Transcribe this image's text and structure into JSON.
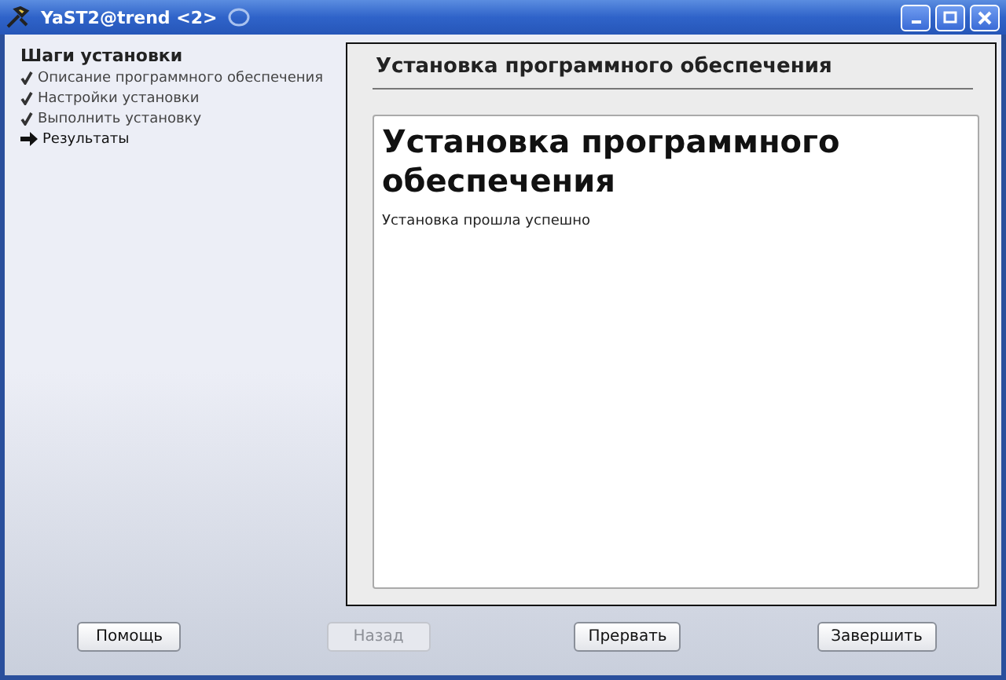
{
  "window": {
    "title": "YaST2@trend <2>"
  },
  "sidebar": {
    "title": "Шаги установки",
    "steps": [
      {
        "label": "Описание программного обеспечения",
        "kind": "done"
      },
      {
        "label": "Настройки установки",
        "kind": "done"
      },
      {
        "label": "Выполнить установку",
        "kind": "done"
      },
      {
        "label": "Результаты",
        "kind": "current"
      }
    ]
  },
  "panel": {
    "title": "Установка программного обеспечения",
    "content": {
      "heading": "Установка программного обеспечения",
      "message": "Установка прошла успешно"
    }
  },
  "buttons": [
    {
      "label": "Помощь",
      "disabled": false
    },
    {
      "label": "Назад",
      "disabled": true
    },
    {
      "label": "Прервать",
      "disabled": false
    },
    {
      "label": "Завершить",
      "disabled": false
    }
  ]
}
